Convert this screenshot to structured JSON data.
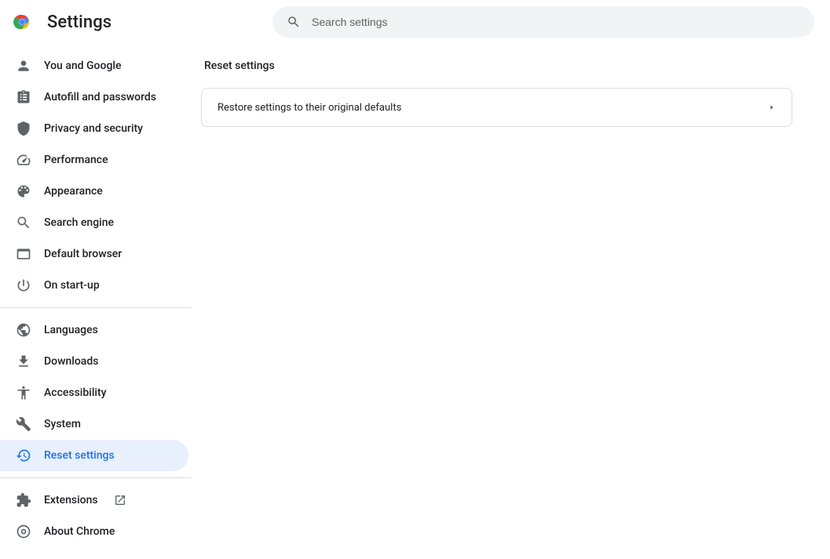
{
  "header": {
    "title": "Settings",
    "search_placeholder": "Search settings"
  },
  "sidebar": {
    "group1": [
      {
        "label": "You and Google",
        "icon": "person-icon"
      },
      {
        "label": "Autofill and passwords",
        "icon": "assignment-icon"
      },
      {
        "label": "Privacy and security",
        "icon": "shield-icon"
      },
      {
        "label": "Performance",
        "icon": "speedometer-icon"
      },
      {
        "label": "Appearance",
        "icon": "palette-icon"
      },
      {
        "label": "Search engine",
        "icon": "search-icon"
      },
      {
        "label": "Default browser",
        "icon": "browser-icon"
      },
      {
        "label": "On start-up",
        "icon": "power-icon"
      }
    ],
    "group2": [
      {
        "label": "Languages",
        "icon": "globe-icon"
      },
      {
        "label": "Downloads",
        "icon": "download-icon"
      },
      {
        "label": "Accessibility",
        "icon": "accessibility-icon"
      },
      {
        "label": "System",
        "icon": "wrench-icon"
      },
      {
        "label": "Reset settings",
        "icon": "restore-icon",
        "active": true
      }
    ],
    "group3": [
      {
        "label": "Extensions",
        "icon": "extension-icon",
        "external": true
      },
      {
        "label": "About Chrome",
        "icon": "chrome-outline-icon"
      }
    ]
  },
  "main": {
    "section_title": "Reset settings",
    "rows": [
      {
        "label": "Restore settings to their original defaults"
      }
    ]
  }
}
